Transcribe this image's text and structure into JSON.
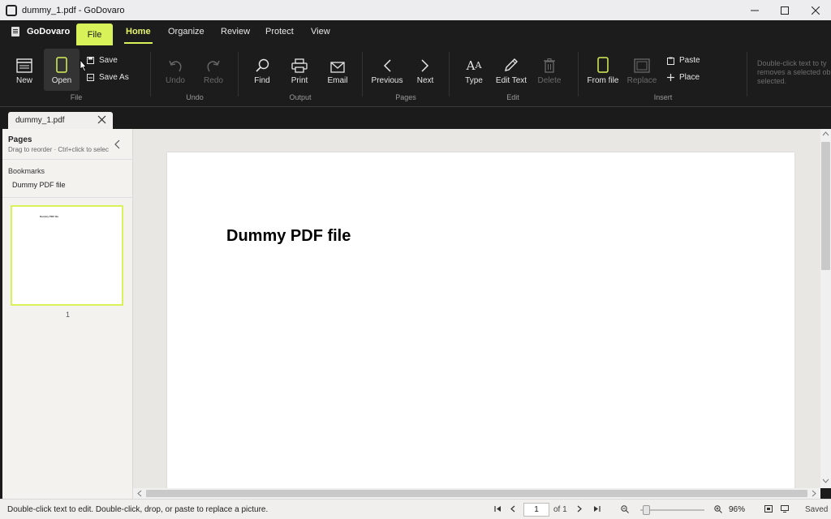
{
  "window": {
    "title": "dummy_1.pdf - GoDovaro"
  },
  "menu": {
    "brand": "GoDovaro",
    "file": "File",
    "tabs": [
      "Home",
      "Organize",
      "Review",
      "Protect",
      "View"
    ]
  },
  "ribbon": {
    "new": "New",
    "open": "Open",
    "save": "Save",
    "save_as": "Save As",
    "undo": "Undo",
    "redo": "Redo",
    "find": "Find",
    "print": "Print",
    "email": "Email",
    "previous": "Previous",
    "next": "Next",
    "type": "Type",
    "edit_text": "Edit Text",
    "delete": "Delete",
    "from_file": "From file",
    "replace": "Replace",
    "paste": "Paste",
    "place": "Place",
    "groups": {
      "file": "File",
      "undo": "Undo",
      "output": "Output",
      "pages": "Pages",
      "edit": "Edit",
      "insert": "Insert"
    },
    "hint_lines": [
      "Double-click text to ty",
      "removes a selected ob",
      "selected."
    ]
  },
  "doc_tab": {
    "name": "dummy_1.pdf"
  },
  "sidebar": {
    "pages_title": "Pages",
    "pages_sub": "Drag to reorder · Ctrl+click to selec",
    "bookmarks_title": "Bookmarks",
    "bookmark_item": "Dummy PDF file",
    "thumb_text": "Dummy PDF file",
    "thumb_number": "1"
  },
  "document": {
    "heading": "Dummy PDF file"
  },
  "status": {
    "message": "Double-click text to edit. Double-click, drop, or paste to replace a picture.",
    "page": "1",
    "of": "of 1",
    "zoom": "96%",
    "saved": "Saved"
  },
  "colors": {
    "accent": "#d8f25a",
    "ribbon_bg": "#1c1c1c",
    "canvas_bg": "#e8e7e4"
  }
}
